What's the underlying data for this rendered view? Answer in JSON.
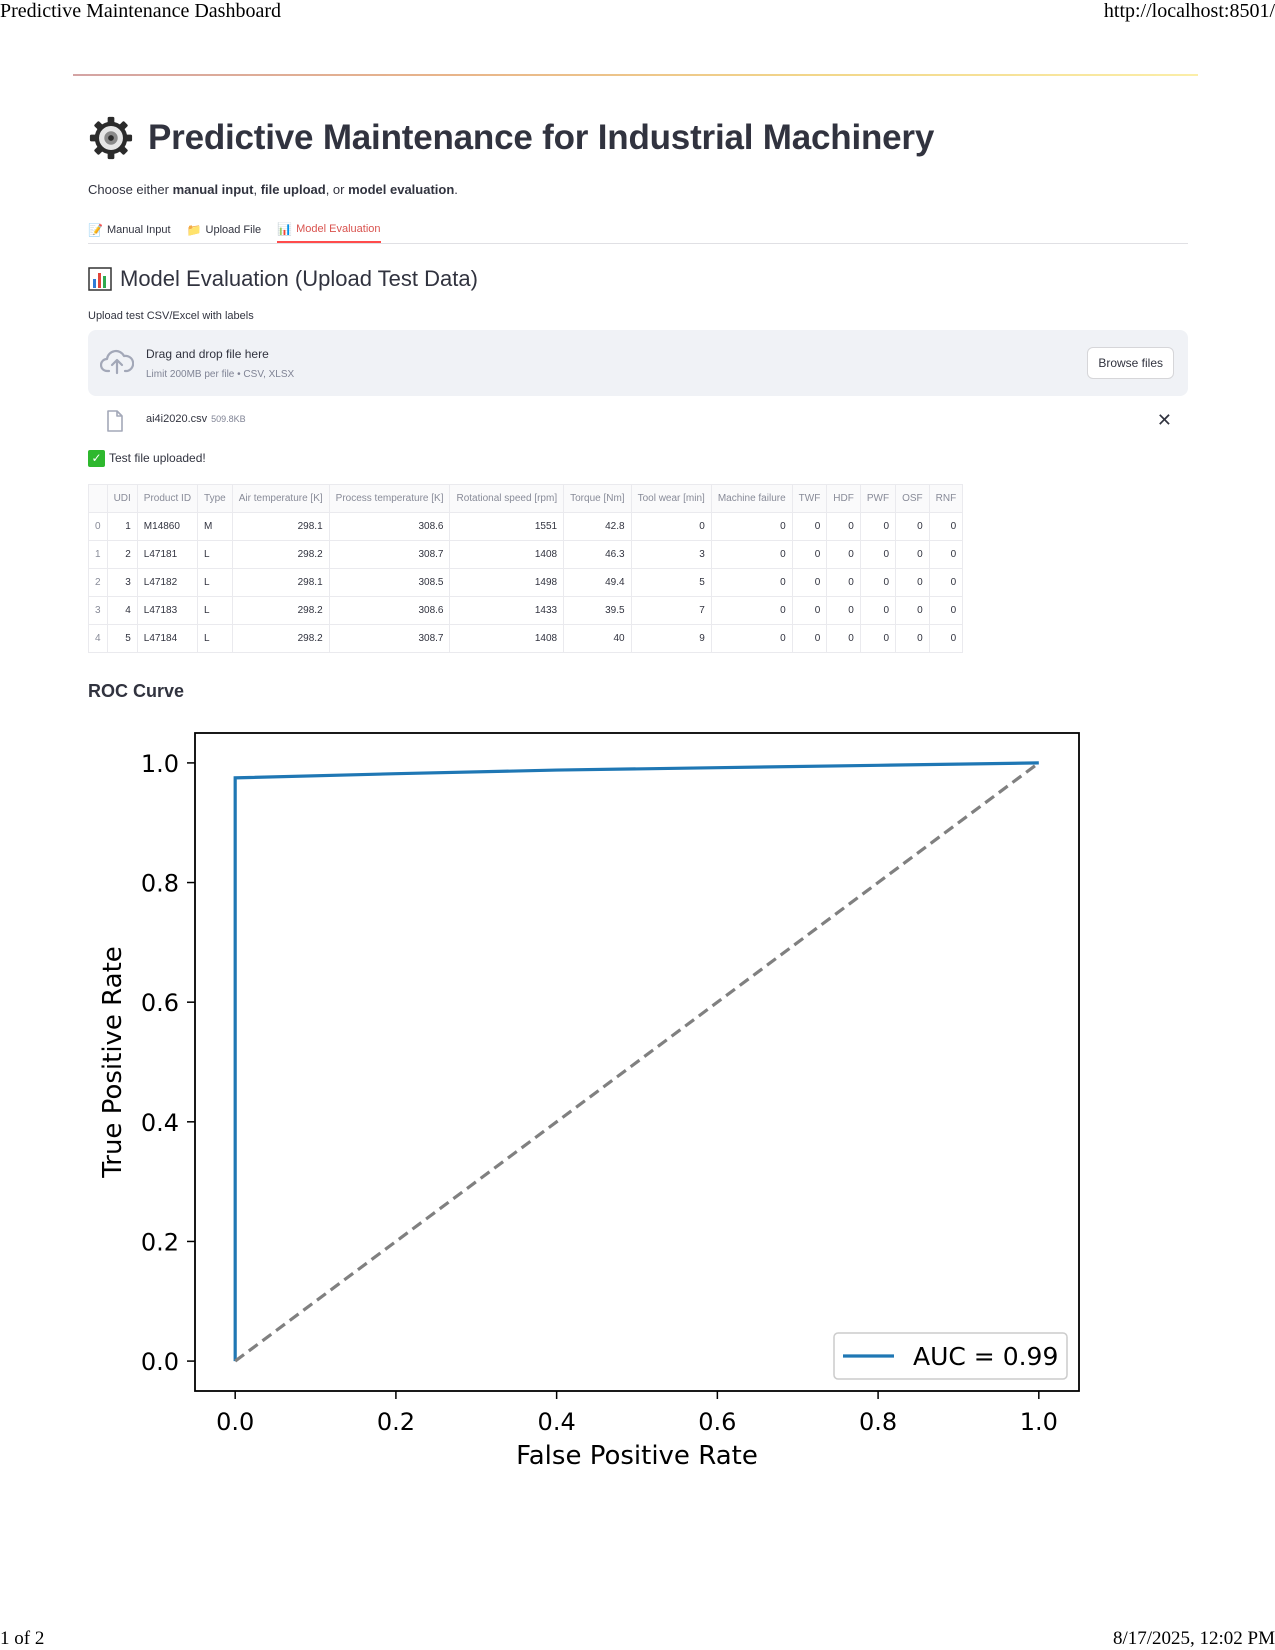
{
  "print": {
    "header_left": "Predictive Maintenance Dashboard",
    "header_right": "http://localhost:8501/",
    "footer_left": "1 of 2",
    "footer_right": "8/17/2025, 12:02 PM"
  },
  "header": {
    "title": "Predictive Maintenance for Industrial Machinery",
    "subtitle_prefix": "Choose either ",
    "subtitle_opt1": "manual input",
    "subtitle_sep1": ", ",
    "subtitle_opt2": "file upload",
    "subtitle_sep2": ", or ",
    "subtitle_opt3": "model evaluation",
    "subtitle_suffix": ".",
    "icon": "gear-icon"
  },
  "tabs": [
    {
      "label": "Manual Input",
      "icon": "📝"
    },
    {
      "label": "Upload File",
      "icon": "📁"
    },
    {
      "label": "Model Evaluation",
      "icon": "📊"
    }
  ],
  "active_tab": "Model Evaluation",
  "section": {
    "title": "Model Evaluation (Upload Test Data)",
    "upload_label": "Upload test CSV/Excel with labels",
    "dropzone_title": "Drag and drop file here",
    "dropzone_limit": "Limit 200MB per file • CSV, XLSX",
    "browse_label": "Browse files",
    "file_name": "ai4i2020.csv",
    "file_size": "509.8KB",
    "success_msg": "Test file uploaded!"
  },
  "table": {
    "columns": [
      "",
      "UDI",
      "Product ID",
      "Type",
      "Air temperature [K]",
      "Process temperature [K]",
      "Rotational speed [rpm]",
      "Torque [Nm]",
      "Tool wear [min]",
      "Machine failure",
      "TWF",
      "HDF",
      "PWF",
      "OSF",
      "RNF"
    ],
    "rows": [
      [
        "0",
        "1",
        "M14860",
        "M",
        "298.1",
        "308.6",
        "1551",
        "42.8",
        "0",
        "0",
        "0",
        "0",
        "0",
        "0",
        "0"
      ],
      [
        "1",
        "2",
        "L47181",
        "L",
        "298.2",
        "308.7",
        "1408",
        "46.3",
        "3",
        "0",
        "0",
        "0",
        "0",
        "0",
        "0"
      ],
      [
        "2",
        "3",
        "L47182",
        "L",
        "298.1",
        "308.5",
        "1498",
        "49.4",
        "5",
        "0",
        "0",
        "0",
        "0",
        "0",
        "0"
      ],
      [
        "3",
        "4",
        "L47183",
        "L",
        "298.2",
        "308.6",
        "1433",
        "39.5",
        "7",
        "0",
        "0",
        "0",
        "0",
        "0",
        "0"
      ],
      [
        "4",
        "5",
        "L47184",
        "L",
        "298.2",
        "308.7",
        "1408",
        "40",
        "9",
        "0",
        "0",
        "0",
        "0",
        "0",
        "0"
      ]
    ]
  },
  "roc_heading": "ROC Curve",
  "chart_data": {
    "type": "line",
    "title": "",
    "xlabel": "False Positive Rate",
    "ylabel": "True Positive Rate",
    "xlim": [
      -0.05,
      1.05
    ],
    "ylim": [
      -0.05,
      1.05
    ],
    "xticks": [
      "0.0",
      "0.2",
      "0.4",
      "0.6",
      "0.8",
      "1.0"
    ],
    "yticks": [
      "0.0",
      "0.2",
      "0.4",
      "0.6",
      "0.8",
      "1.0"
    ],
    "grid": false,
    "legend_position": "lower-right",
    "series": [
      {
        "name": "AUC = 0.99",
        "color": "#1f77b4",
        "style": "solid",
        "x": [
          0.0,
          0.0,
          0.2,
          0.4,
          0.6,
          0.8,
          1.0
        ],
        "y": [
          0.0,
          0.975,
          0.982,
          0.988,
          0.992,
          0.996,
          1.0
        ]
      },
      {
        "name": "",
        "color": "#808080",
        "style": "dashed",
        "x": [
          0.0,
          1.0
        ],
        "y": [
          0.0,
          1.0
        ]
      }
    ]
  }
}
